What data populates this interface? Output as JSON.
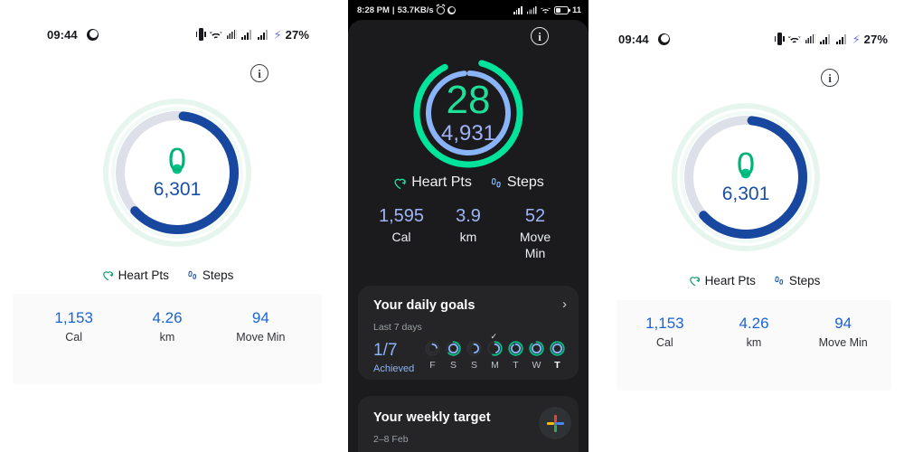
{
  "screens": {
    "left": {
      "status_bar": {
        "time": "09:44",
        "battery_percent": "27%",
        "icons": [
          "moon-icon",
          "vibrate-icon",
          "wifi-icon",
          "vpn-icon",
          "signal-icon",
          "signal-icon",
          "charging-bolt-icon"
        ]
      },
      "info_label": "i",
      "ring": {
        "heart_points": "0",
        "steps": "6,301",
        "heart_arc_degrees": 4,
        "steps_arc_degrees": 222,
        "heart_color": "#00b377",
        "steps_color": "#174ea6",
        "track_color": "#dcdfe6",
        "halo_color": "#e2f5ec"
      },
      "legend": [
        {
          "icon": "heart-points-icon",
          "label": "Heart Pts"
        },
        {
          "icon": "steps-icon",
          "label": "Steps"
        }
      ],
      "stats": [
        {
          "value": "1,153",
          "unit": "Cal"
        },
        {
          "value": "4.26",
          "unit": "km"
        },
        {
          "value": "94",
          "unit": "Move Min"
        }
      ]
    },
    "center": {
      "status_bar": {
        "time": "8:28 PM",
        "net_speed": "53.7KB/s",
        "battery_percent": "11",
        "icons": [
          "alarm-icon",
          "moon-icon",
          "signal-icon",
          "vpn-icon",
          "wifi-icon",
          "battery-icon"
        ]
      },
      "info_label": "i",
      "ring": {
        "heart_points": "28",
        "steps": "4,931",
        "heart_arc_degrees": 300,
        "steps_arc_degrees": 352,
        "heart_color": "#00e39a",
        "steps_color": "#8ab4f8",
        "track_color": "#2a2a2d"
      },
      "legend": [
        {
          "icon": "heart-points-icon",
          "label": "Heart Pts"
        },
        {
          "icon": "steps-icon",
          "label": "Steps"
        }
      ],
      "stats": [
        {
          "value": "1,595",
          "unit": "Cal"
        },
        {
          "value": "3.9",
          "unit": "km"
        },
        {
          "value": "52",
          "unit": "Move\nMin"
        }
      ],
      "daily_goals_card": {
        "title": "Your daily goals",
        "subtitle": "Last 7 days",
        "achieved_count": "1/7",
        "achieved_label": "Achieved",
        "chevron": "›",
        "check_mark": "✓",
        "days": [
          {
            "label": "F",
            "heart_pct": 0,
            "steps_pct": 22,
            "today": false,
            "checked": false
          },
          {
            "label": "S",
            "heart_pct": 62,
            "steps_pct": 96,
            "today": false,
            "checked": false
          },
          {
            "label": "S",
            "heart_pct": 0,
            "steps_pct": 48,
            "today": false,
            "checked": false
          },
          {
            "label": "M",
            "heart_pct": 55,
            "steps_pct": 45,
            "today": false,
            "checked": false
          },
          {
            "label": "T",
            "heart_pct": 100,
            "steps_pct": 90,
            "today": false,
            "checked": true
          },
          {
            "label": "W",
            "heart_pct": 88,
            "steps_pct": 96,
            "today": false,
            "checked": false
          },
          {
            "label": "T",
            "heart_pct": 96,
            "steps_pct": 96,
            "today": true,
            "checked": false
          }
        ]
      },
      "weekly_target_card": {
        "title": "Your weekly target",
        "subtitle": "2–8 Feb",
        "fab_icon": "google-plus-icon"
      }
    },
    "right": {
      "status_bar": {
        "time": "09:44",
        "battery_percent": "27%",
        "icons": [
          "moon-icon",
          "vibrate-icon",
          "wifi-icon",
          "vpn-icon",
          "signal-icon",
          "signal-icon",
          "charging-bolt-icon"
        ]
      },
      "info_label": "i",
      "ring": {
        "heart_points": "0",
        "steps": "6,301",
        "heart_arc_degrees": 4,
        "steps_arc_degrees": 222,
        "heart_color": "#00b377",
        "steps_color": "#174ea6",
        "track_color": "#dcdfe6",
        "halo_color": "#e2f5ec"
      },
      "legend": [
        {
          "icon": "heart-points-icon",
          "label": "Heart Pts"
        },
        {
          "icon": "steps-icon",
          "label": "Steps"
        }
      ],
      "stats": [
        {
          "value": "1,153",
          "unit": "Cal"
        },
        {
          "value": "4.26",
          "unit": "km"
        },
        {
          "value": "94",
          "unit": "Move Min"
        }
      ]
    }
  }
}
